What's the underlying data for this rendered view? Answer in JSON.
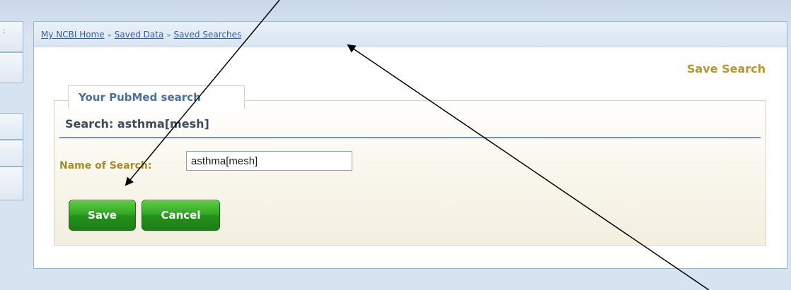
{
  "breadcrumb": {
    "items": [
      "My NCBI Home",
      "Saved Data",
      "Saved Searches"
    ],
    "separator": "»"
  },
  "page": {
    "title": "Save Search"
  },
  "form": {
    "legend": "Your PubMed search",
    "search_label": "Search: asthma[mesh]",
    "name_label": "Name of Search:",
    "name_value": "asthma[mesh]",
    "save_label": "Save",
    "cancel_label": "Cancel"
  },
  "colors": {
    "accent_gold": "#b8962e",
    "link_blue": "#3a5f95",
    "button_green": "#2fa524"
  }
}
